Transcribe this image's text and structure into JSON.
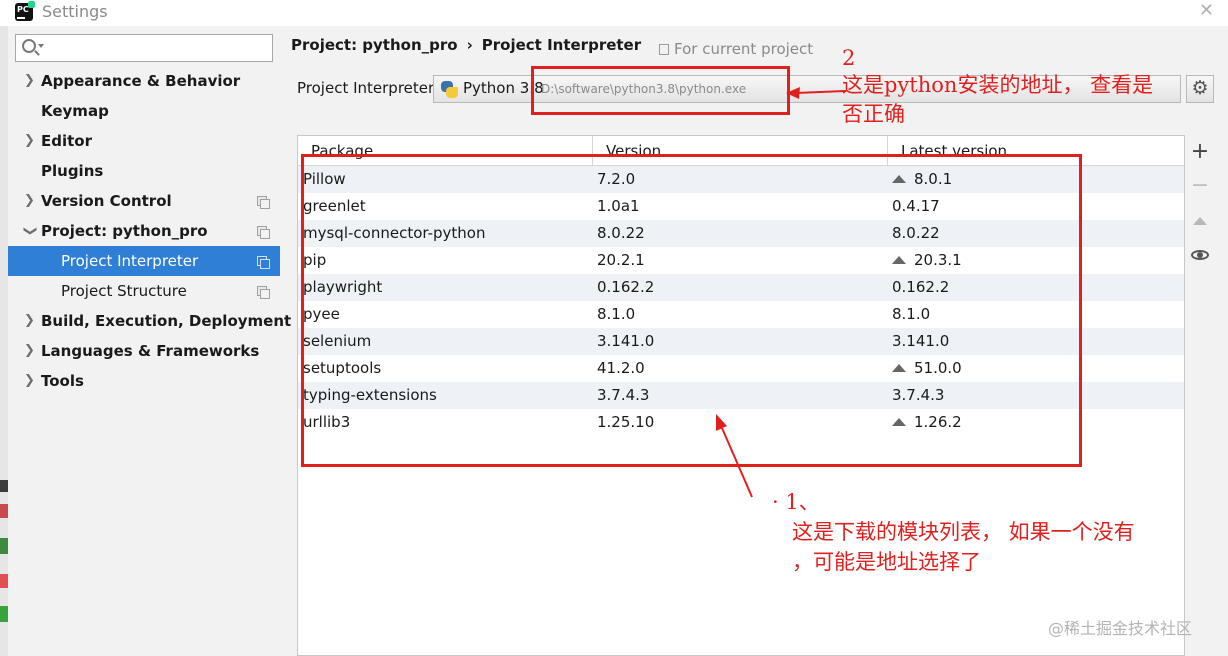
{
  "window": {
    "title": "Settings"
  },
  "search": {
    "placeholder": ""
  },
  "sidebar": {
    "items": [
      {
        "label": "Appearance & Behavior",
        "expandable": true,
        "expanded": false
      },
      {
        "label": "Keymap",
        "expandable": false
      },
      {
        "label": "Editor",
        "expandable": true,
        "expanded": false
      },
      {
        "label": "Plugins",
        "expandable": false
      },
      {
        "label": "Version Control",
        "expandable": true,
        "expanded": false
      },
      {
        "label": "Project: python_pro",
        "expandable": true,
        "expanded": true
      },
      {
        "label": "Project Interpreter",
        "child": true,
        "selected": true
      },
      {
        "label": "Project Structure",
        "child": true
      },
      {
        "label": "Build, Execution, Deployment",
        "expandable": true,
        "expanded": false
      },
      {
        "label": "Languages & Frameworks",
        "expandable": true,
        "expanded": false
      },
      {
        "label": "Tools",
        "expandable": true,
        "expanded": false
      }
    ]
  },
  "breadcrumb": {
    "parent": "Project: python_pro",
    "separator": "›",
    "current": "Project Interpreter"
  },
  "scope": {
    "label": "For current project"
  },
  "interpreter": {
    "label": "Project Interpreter:",
    "name": "Python 3.8",
    "path": "D:\\software\\python3.8\\python.exe"
  },
  "table": {
    "headers": [
      "Package",
      "Version",
      "Latest version"
    ],
    "rows": [
      {
        "package": "Pillow",
        "version": "7.2.0",
        "latest": "8.0.1",
        "upgrade": true
      },
      {
        "package": "greenlet",
        "version": "1.0a1",
        "latest": "0.4.17",
        "upgrade": false
      },
      {
        "package": "mysql-connector-python",
        "version": "8.0.22",
        "latest": "8.0.22",
        "upgrade": false
      },
      {
        "package": "pip",
        "version": "20.2.1",
        "latest": "20.3.1",
        "upgrade": true
      },
      {
        "package": "playwright",
        "version": "0.162.2",
        "latest": "0.162.2",
        "upgrade": false
      },
      {
        "package": "pyee",
        "version": "8.1.0",
        "latest": "8.1.0",
        "upgrade": false
      },
      {
        "package": "selenium",
        "version": "3.141.0",
        "latest": "3.141.0",
        "upgrade": false
      },
      {
        "package": "setuptools",
        "version": "41.2.0",
        "latest": "51.0.0",
        "upgrade": true
      },
      {
        "package": "typing-extensions",
        "version": "3.7.4.3",
        "latest": "3.7.4.3",
        "upgrade": false
      },
      {
        "package": "urllib3",
        "version": "1.25.10",
        "latest": "1.26.2",
        "upgrade": true
      }
    ]
  },
  "annotations": {
    "note2_number": "2",
    "note2_line1": "这是python安装的地址， 查看是",
    "note2_line2": "否正确",
    "note1_number": "·  1、",
    "note1_line1": "这是下载的模块列表，  如果一个没有",
    "note1_line2": "，可能是地址选择了"
  },
  "watermark": "@稀土掘金技术社区",
  "colors": {
    "selection": "#2f7fd6",
    "annotation": "#e0201e",
    "alt_row": "#eef2f7"
  }
}
